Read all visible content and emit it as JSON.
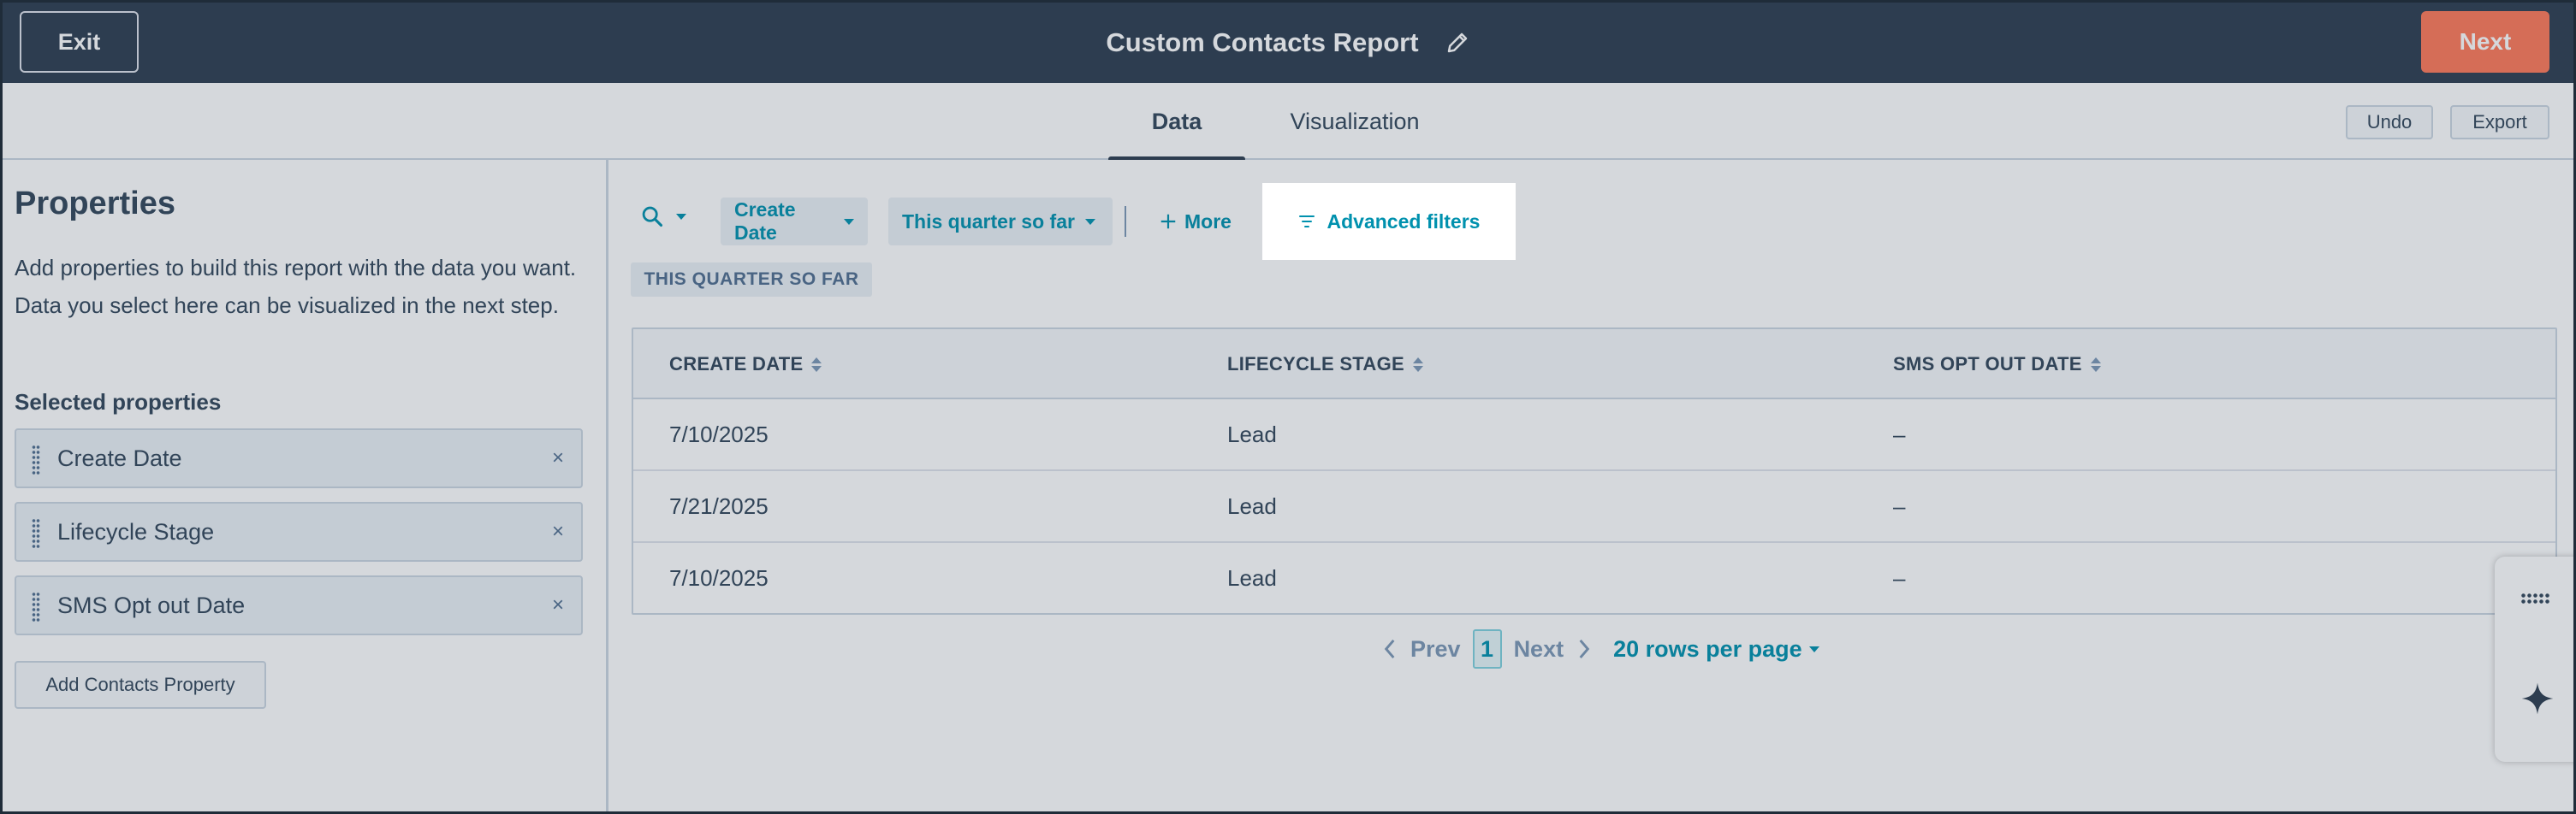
{
  "header": {
    "exit_label": "Exit",
    "title": "Custom Contacts Report",
    "next_label": "Next"
  },
  "tabs": {
    "items": [
      {
        "label": "Data"
      },
      {
        "label": "Visualization"
      }
    ],
    "undo_label": "Undo",
    "export_label": "Export"
  },
  "sidebar": {
    "title": "Properties",
    "description": "Add properties to build this report with the data you want. Data you select here can be visualized in the next step.",
    "selected_heading": "Selected properties",
    "properties": [
      {
        "label": "Create Date",
        "remove": "×"
      },
      {
        "label": "Lifecycle Stage",
        "remove": "×"
      },
      {
        "label": "SMS Opt out Date",
        "remove": "×"
      }
    ],
    "add_label": "Add Contacts Property"
  },
  "filters": {
    "date_chip": "Create Date",
    "range_chip": "This quarter so far",
    "more_label": "More",
    "advanced_label": "Advanced filters",
    "active_tag": "THIS QUARTER SO FAR"
  },
  "table": {
    "headers": [
      "CREATE DATE",
      "LIFECYCLE STAGE",
      "SMS OPT OUT DATE"
    ],
    "rows": [
      [
        "7/10/2025",
        "Lead",
        "–"
      ],
      [
        "7/21/2025",
        "Lead",
        "–"
      ],
      [
        "7/10/2025",
        "Lead",
        "–"
      ]
    ]
  },
  "pagination": {
    "prev_label": "Prev",
    "current_page": "1",
    "next_label": "Next",
    "rows_per_page": "20 rows per page"
  },
  "colors": {
    "header_bg": "#2d3e50",
    "accent": "#ff7a59",
    "link": "#0091ae"
  }
}
